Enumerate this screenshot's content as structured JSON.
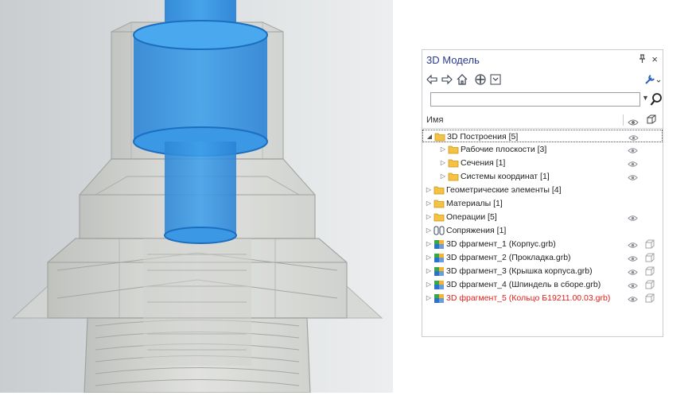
{
  "panel": {
    "title": "3D Модель",
    "pin_icon": "pin-icon",
    "close_label": "×",
    "search": {
      "value": "",
      "placeholder": ""
    },
    "column_name": "Имя",
    "colors": {
      "title": "#2b3a8c",
      "error": "#e0201a",
      "folder": "#f6c244"
    }
  },
  "tree": [
    {
      "label": "3D Построения [5]",
      "level": 0,
      "expand": "open",
      "icon": "folder-icon",
      "eye": true,
      "cube": false,
      "selected": true,
      "error": false
    },
    {
      "label": "Рабочие плоскости [3]",
      "level": 1,
      "expand": "closed",
      "icon": "folder-icon",
      "eye": true,
      "cube": false,
      "selected": false,
      "error": false
    },
    {
      "label": "Сечения [1]",
      "level": 1,
      "expand": "closed",
      "icon": "folder-icon",
      "eye": true,
      "cube": false,
      "selected": false,
      "error": false
    },
    {
      "label": "Системы координат [1]",
      "level": 1,
      "expand": "closed",
      "icon": "folder-icon",
      "eye": true,
      "cube": false,
      "selected": false,
      "error": false
    },
    {
      "label": "Геометрические элементы [4]",
      "level": 0,
      "expand": "closed",
      "icon": "folder-icon",
      "eye": false,
      "cube": false,
      "selected": false,
      "error": false
    },
    {
      "label": "Материалы [1]",
      "level": 0,
      "expand": "closed",
      "icon": "folder-icon",
      "eye": false,
      "cube": false,
      "selected": false,
      "error": false
    },
    {
      "label": "Операции [5]",
      "level": 0,
      "expand": "closed",
      "icon": "folder-icon",
      "eye": true,
      "cube": false,
      "selected": false,
      "error": false
    },
    {
      "label": "Сопряжения [1]",
      "level": 0,
      "expand": "closed",
      "icon": "mate-icon",
      "eye": false,
      "cube": false,
      "selected": false,
      "error": false
    },
    {
      "label": "3D фрагмент_1 (Корпус.grb)",
      "level": 0,
      "expand": "closed",
      "icon": "fragment-icon",
      "eye": true,
      "cube": true,
      "selected": false,
      "error": false
    },
    {
      "label": "3D фрагмент_2 (Прокладка.grb)",
      "level": 0,
      "expand": "closed",
      "icon": "fragment-icon",
      "eye": true,
      "cube": true,
      "selected": false,
      "error": false
    },
    {
      "label": "3D фрагмент_3 (Крышка корпуса.grb)",
      "level": 0,
      "expand": "closed",
      "icon": "fragment-icon",
      "eye": true,
      "cube": true,
      "selected": false,
      "error": false
    },
    {
      "label": "3D фрагмент_4 (Шпиндель в сборе.grb)",
      "level": 0,
      "expand": "closed",
      "icon": "fragment-icon",
      "eye": true,
      "cube": true,
      "selected": false,
      "error": false
    },
    {
      "label": "3D фрагмент_5 (Кольцо Б19211.00.03.grb)",
      "level": 0,
      "expand": "closed",
      "icon": "fragment-icon",
      "eye": true,
      "cube": true,
      "selected": false,
      "error": true
    }
  ]
}
